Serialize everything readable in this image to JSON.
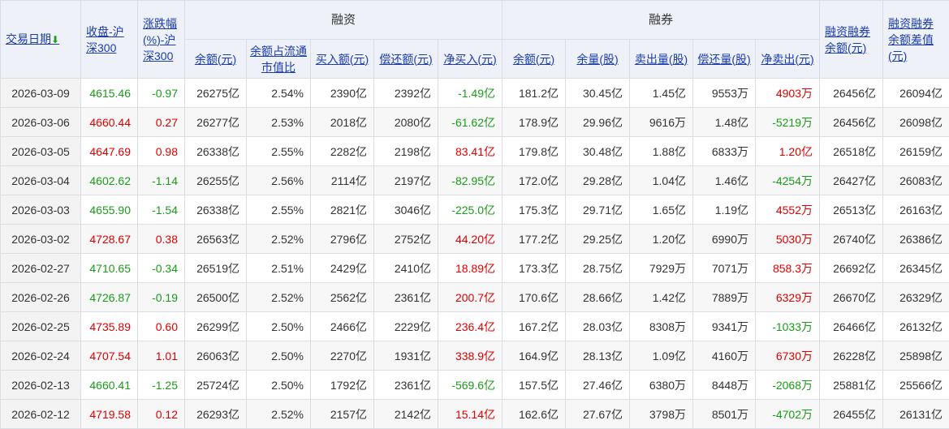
{
  "headers": {
    "date": "交易日期",
    "close": "收盘-沪深300",
    "change": "涨跌幅(%)-沪深300",
    "rz_group": "融资",
    "rq_group": "融券",
    "rz_balance": "余额(元)",
    "rz_ratio": "余额占流通市值比",
    "rz_buy": "买入额(元)",
    "rz_repay": "偿还额(元)",
    "rz_net": "净买入(元)",
    "rq_balance": "余额(元)",
    "rq_volume": "余量(股)",
    "rq_sell": "卖出量(股)",
    "rq_repay": "偿还量(股)",
    "rq_net": "净卖出(元)",
    "total_balance": "融资融券余额(元)",
    "diff_balance": "融资融券余额差值(元)"
  },
  "colors": {
    "up": "#e10000",
    "down": "#1a9b1a",
    "link": "#1a3cad"
  },
  "rows": [
    {
      "date": "2026-03-09",
      "close": "4615.46",
      "change": "-0.97",
      "rz_balance": "26275亿",
      "rz_ratio": "2.54%",
      "rz_buy": "2390亿",
      "rz_repay": "2392亿",
      "rz_net": "-1.49亿",
      "rq_balance": "181.2亿",
      "rq_volume": "30.45亿",
      "rq_sell": "1.45亿",
      "rq_repay": "9553万",
      "rq_net": "4903万",
      "total": "26456亿",
      "diff": "26094亿"
    },
    {
      "date": "2026-03-06",
      "close": "4660.44",
      "change": "0.27",
      "rz_balance": "26277亿",
      "rz_ratio": "2.53%",
      "rz_buy": "2018亿",
      "rz_repay": "2080亿",
      "rz_net": "-61.62亿",
      "rq_balance": "178.9亿",
      "rq_volume": "29.96亿",
      "rq_sell": "9616万",
      "rq_repay": "1.48亿",
      "rq_net": "-5219万",
      "total": "26456亿",
      "diff": "26098亿"
    },
    {
      "date": "2026-03-05",
      "close": "4647.69",
      "change": "0.98",
      "rz_balance": "26338亿",
      "rz_ratio": "2.55%",
      "rz_buy": "2282亿",
      "rz_repay": "2198亿",
      "rz_net": "83.41亿",
      "rq_balance": "179.8亿",
      "rq_volume": "30.48亿",
      "rq_sell": "1.88亿",
      "rq_repay": "6833万",
      "rq_net": "1.20亿",
      "total": "26518亿",
      "diff": "26159亿"
    },
    {
      "date": "2026-03-04",
      "close": "4602.62",
      "change": "-1.14",
      "rz_balance": "26255亿",
      "rz_ratio": "2.56%",
      "rz_buy": "2114亿",
      "rz_repay": "2197亿",
      "rz_net": "-82.95亿",
      "rq_balance": "172.0亿",
      "rq_volume": "29.28亿",
      "rq_sell": "1.04亿",
      "rq_repay": "1.46亿",
      "rq_net": "-4254万",
      "total": "26427亿",
      "diff": "26083亿"
    },
    {
      "date": "2026-03-03",
      "close": "4655.90",
      "change": "-1.54",
      "rz_balance": "26338亿",
      "rz_ratio": "2.55%",
      "rz_buy": "2821亿",
      "rz_repay": "3046亿",
      "rz_net": "-225.0亿",
      "rq_balance": "175.3亿",
      "rq_volume": "29.71亿",
      "rq_sell": "1.65亿",
      "rq_repay": "1.19亿",
      "rq_net": "4552万",
      "total": "26513亿",
      "diff": "26163亿"
    },
    {
      "date": "2026-03-02",
      "close": "4728.67",
      "change": "0.38",
      "rz_balance": "26563亿",
      "rz_ratio": "2.52%",
      "rz_buy": "2796亿",
      "rz_repay": "2752亿",
      "rz_net": "44.20亿",
      "rq_balance": "177.2亿",
      "rq_volume": "29.25亿",
      "rq_sell": "1.20亿",
      "rq_repay": "6990万",
      "rq_net": "5030万",
      "total": "26740亿",
      "diff": "26386亿"
    },
    {
      "date": "2026-02-27",
      "close": "4710.65",
      "change": "-0.34",
      "rz_balance": "26519亿",
      "rz_ratio": "2.51%",
      "rz_buy": "2429亿",
      "rz_repay": "2410亿",
      "rz_net": "18.89亿",
      "rq_balance": "173.3亿",
      "rq_volume": "28.75亿",
      "rq_sell": "7929万",
      "rq_repay": "7071万",
      "rq_net": "858.3万",
      "total": "26692亿",
      "diff": "26345亿"
    },
    {
      "date": "2026-02-26",
      "close": "4726.87",
      "change": "-0.19",
      "rz_balance": "26500亿",
      "rz_ratio": "2.52%",
      "rz_buy": "2562亿",
      "rz_repay": "2361亿",
      "rz_net": "200.7亿",
      "rq_balance": "170.6亿",
      "rq_volume": "28.66亿",
      "rq_sell": "1.42亿",
      "rq_repay": "7889万",
      "rq_net": "6329万",
      "total": "26670亿",
      "diff": "26329亿"
    },
    {
      "date": "2026-02-25",
      "close": "4735.89",
      "change": "0.60",
      "rz_balance": "26299亿",
      "rz_ratio": "2.50%",
      "rz_buy": "2466亿",
      "rz_repay": "2229亿",
      "rz_net": "236.4亿",
      "rq_balance": "167.2亿",
      "rq_volume": "28.03亿",
      "rq_sell": "8308万",
      "rq_repay": "9341万",
      "rq_net": "-1033万",
      "total": "26466亿",
      "diff": "26132亿"
    },
    {
      "date": "2026-02-24",
      "close": "4707.54",
      "change": "1.01",
      "rz_balance": "26063亿",
      "rz_ratio": "2.50%",
      "rz_buy": "2270亿",
      "rz_repay": "1931亿",
      "rz_net": "338.9亿",
      "rq_balance": "164.9亿",
      "rq_volume": "28.13亿",
      "rq_sell": "1.09亿",
      "rq_repay": "4160万",
      "rq_net": "6730万",
      "total": "26228亿",
      "diff": "25898亿"
    },
    {
      "date": "2026-02-13",
      "close": "4660.41",
      "change": "-1.25",
      "rz_balance": "25724亿",
      "rz_ratio": "2.50%",
      "rz_buy": "1792亿",
      "rz_repay": "2361亿",
      "rz_net": "-569.6亿",
      "rq_balance": "157.5亿",
      "rq_volume": "27.46亿",
      "rq_sell": "6380万",
      "rq_repay": "8448万",
      "rq_net": "-2068万",
      "total": "25881亿",
      "diff": "25566亿"
    },
    {
      "date": "2026-02-12",
      "close": "4719.58",
      "change": "0.12",
      "rz_balance": "26293亿",
      "rz_ratio": "2.52%",
      "rz_buy": "2157亿",
      "rz_repay": "2142亿",
      "rz_net": "15.14亿",
      "rq_balance": "162.6亿",
      "rq_volume": "27.67亿",
      "rq_sell": "3798万",
      "rq_repay": "8501万",
      "rq_net": "-4702万",
      "total": "26455亿",
      "diff": "26131亿"
    }
  ]
}
